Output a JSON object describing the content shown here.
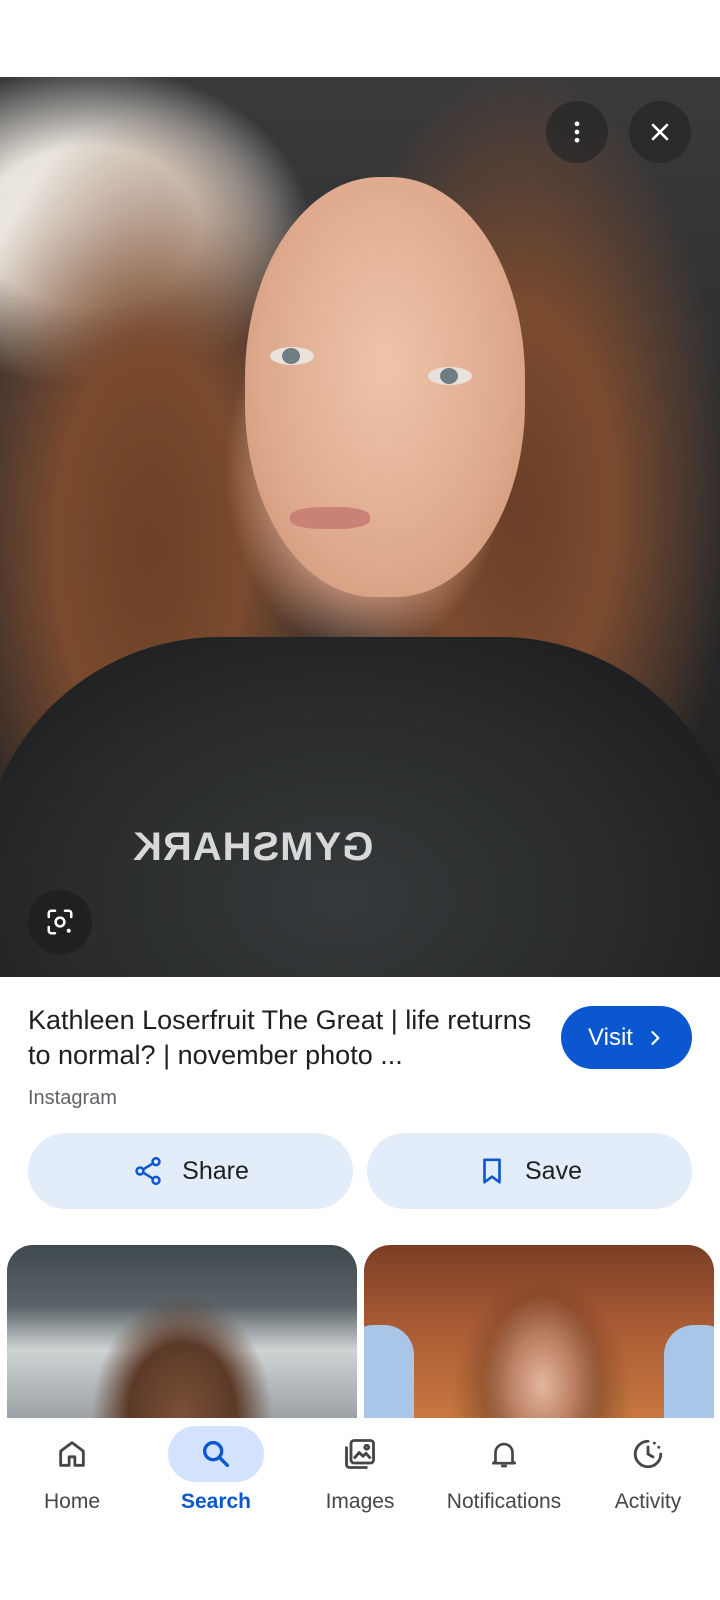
{
  "result": {
    "title": "Kathleen Loserfruit The Great | life returns to normal? | november photo ...",
    "source": "Instagram",
    "visit_label": "Visit",
    "share_label": "Share",
    "save_label": "Save"
  },
  "image": {
    "shirt_text": "GYMSHARK"
  },
  "icons": {
    "more": "more-vert-icon",
    "close": "close-icon",
    "lens": "lens-icon",
    "visit": "chevron-right-icon",
    "share": "share-icon",
    "save": "bookmark-icon"
  },
  "bottom_nav": {
    "active": "Search",
    "items": [
      {
        "label": "Home",
        "icon": "home-icon"
      },
      {
        "label": "Search",
        "icon": "search-icon"
      },
      {
        "label": "Images",
        "icon": "images-icon"
      },
      {
        "label": "Notifications",
        "icon": "bell-icon"
      },
      {
        "label": "Activity",
        "icon": "activity-icon"
      }
    ]
  },
  "colors": {
    "accent": "#0b57d0",
    "button_tint": "#e3ecf9",
    "active_pill": "#d3e3fd"
  }
}
